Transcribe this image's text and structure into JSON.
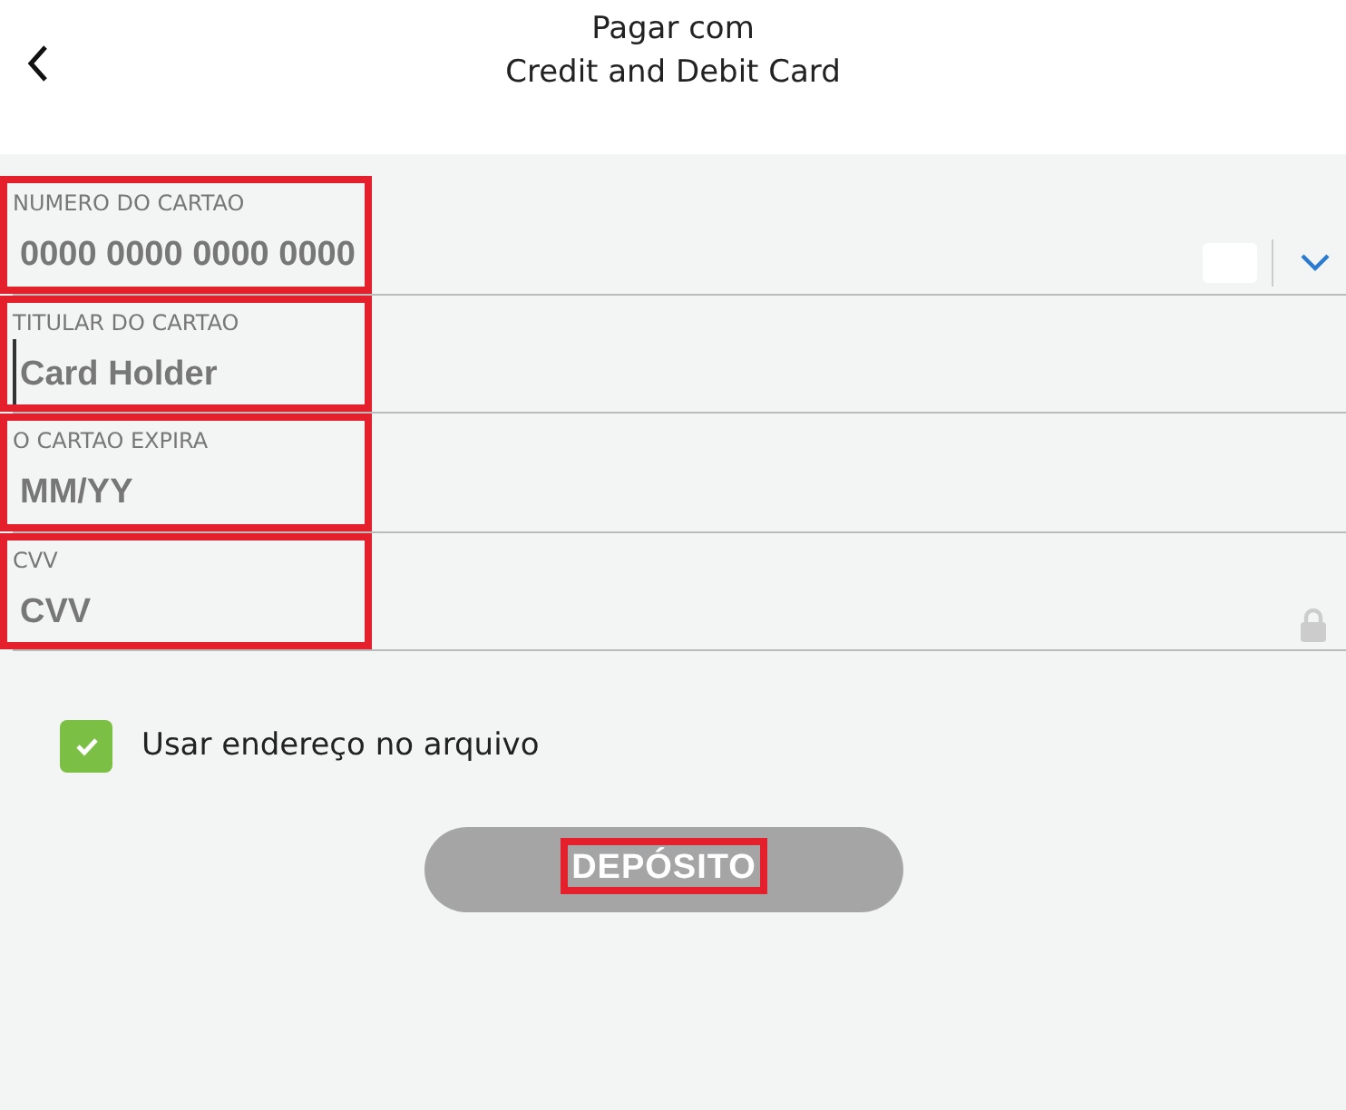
{
  "header": {
    "title": "Pagar com",
    "subtitle": "Credit and Debit Card"
  },
  "fields": [
    {
      "kind": "card",
      "label": "NUMERO DO CARTAO",
      "placeholder": "0000 0000 0000 0000",
      "highlighted": true,
      "focused": false
    },
    {
      "kind": "text",
      "label": "TITULAR DO CARTAO",
      "placeholder": "Card Holder",
      "highlighted": true,
      "focused": true
    },
    {
      "kind": "text",
      "label": "O CARTAO EXPIRA",
      "placeholder": "MM/YY",
      "highlighted": true,
      "focused": false
    },
    {
      "kind": "secure",
      "label": "CVV",
      "placeholder": "CVV",
      "highlighted": true,
      "focused": false
    }
  ],
  "checkbox": {
    "label": "Usar endereço no arquivo",
    "checked": true
  },
  "submit": {
    "label": "DEPÓSITO",
    "disabled": true,
    "highlighted": true
  }
}
